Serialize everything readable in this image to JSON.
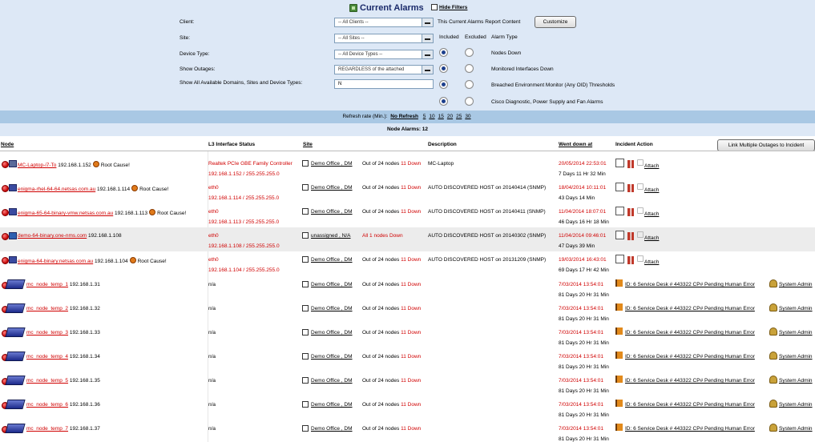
{
  "header": {
    "title": "Current Alarms",
    "hide_filters": "Hide Filters"
  },
  "filters": {
    "client_label": "Client:",
    "client_value": "-- All Clients --",
    "site_label": "Site:",
    "site_value": "-- All Sites --",
    "device_type_label": "Device Type:",
    "device_type_value": "-- All Device Types --",
    "show_outages_label": "Show Outages:",
    "show_outages_value": "REGARDLESS of the attached",
    "show_all_label": "Show All Available Domains, Sites and Device Types:",
    "show_all_value": "N"
  },
  "report": {
    "content_label": "This Current Alarms Report Content",
    "customize_label": "Customize",
    "col_included": "Included",
    "col_excluded": "Excluded",
    "col_alarm_type": "Alarm Type",
    "alarm_types": [
      {
        "label": "Nodes Down",
        "included": true
      },
      {
        "label": "Monitored Interfaces Down",
        "included": true
      },
      {
        "label": "Breached Environment Monitor (Any OID) Thresholds",
        "included": true
      },
      {
        "label": "Cisco Diagnostic, Power Supply and Fan Alarms",
        "included": true
      }
    ]
  },
  "refresh": {
    "label": "Refresh rate (Min.):",
    "current": "No Refresh",
    "options": [
      "5",
      "10",
      "15",
      "20",
      "25",
      "30"
    ]
  },
  "summary": {
    "node_alarms": "Node Alarms: 12"
  },
  "table": {
    "headers": {
      "node": "Node",
      "l3": "L3 Interface Status",
      "site": "Site",
      "description": "Description",
      "went_down": "Went down at",
      "incident_action": "Incident Action"
    },
    "link_multiple_label": "Link Multiple Outages to Incident",
    "root_cause_label": "Root Cause!",
    "attach_label": "Attach",
    "rows": [
      {
        "node_name": "MC-Laptop-i7-To",
        "node_ip": "192.168.1.152",
        "root": true,
        "icon": "laptop-icon",
        "l3_line1": "Realtek PCIe GBE Family Controller",
        "l3_line2": "192.168.1.152 / 255.255.255.0",
        "site": "Demo Office , DM",
        "out_of": "Out of 24 nodes",
        "down": "11 Down",
        "desc": "MC-Laptop",
        "went": "20/05/2014 22:53:01",
        "dur": "7 Days 11 Hr 32 Min",
        "action": "attach",
        "shade": false
      },
      {
        "node_name": "enigma-rhel-64-64.netsas.com.au",
        "node_ip": "192.168.1.114",
        "root": true,
        "icon": "server-icon",
        "l3_line1": "eth0",
        "l3_line2": "192.168.1.114 / 255.255.255.0",
        "site": "Demo Office , DM",
        "out_of": "Out of 24 nodes",
        "down": "11 Down",
        "desc": "AUTO DISCOVERED HOST on 20140414 (SNMP)",
        "went": "18/04/2014 10:11:01",
        "dur": "43 Days 14 Min",
        "action": "attach",
        "shade": false
      },
      {
        "node_name": "enigma-65-64-binary-vmw.netsas.com.au",
        "node_ip": "192.168.1.113",
        "root": true,
        "icon": "server-icon",
        "l3_line1": "eth0",
        "l3_line2": "192.168.1.113 / 255.255.255.0",
        "site": "Demo Office , DM",
        "out_of": "Out of 24 nodes",
        "down": "11 Down",
        "desc": "AUTO DISCOVERED HOST on 20140411 (SNMP)",
        "went": "11/04/2014 18:07:01",
        "dur": "46 Days 16 Hr 18 Min",
        "action": "attach",
        "shade": false
      },
      {
        "node_name": "demo-64-binary.one-nms.com",
        "node_ip": "192.168.1.108",
        "root": false,
        "icon": "pc-icon",
        "l3_line1": "eth0",
        "l3_line2": "192.168.1.108 / 255.255.255.0",
        "site": "unassigned , N/A",
        "out_of": "",
        "down": "All 1 nodes Down",
        "desc": "AUTO DISCOVERED HOST on 20140302 (SNMP)",
        "went": "11/04/2014 09:46:01",
        "dur": "47 Days 39 Min",
        "action": "attach",
        "shade": true
      },
      {
        "node_name": "enigma-64-binary.netsas.com.au",
        "node_ip": "192.168.1.104",
        "root": true,
        "icon": "server-icon",
        "l3_line1": "eth0",
        "l3_line2": "192.168.1.104 / 255.255.255.0",
        "site": "Demo Office , DM",
        "out_of": "Out of 24 nodes",
        "down": "11 Down",
        "desc": "AUTO DISCOVERED HOST on 20131209 (SNMP)",
        "went": "19/03/2014 16:43:01",
        "dur": "69 Days 17 Hr 42 Min",
        "action": "attach",
        "shade": false
      },
      {
        "node_name": "mc_node_temp_1",
        "node_ip": "192.168.1.31",
        "root": false,
        "icon": "switch-icon",
        "l3_line1": "n/a",
        "l3_line2": "",
        "site": "Demo Office , DM",
        "out_of": "Out of 24 nodes",
        "down": "11 Down",
        "desc": "",
        "went": "7/03/2014 13:54:01",
        "dur": "81 Days 20 Hr 31 Min",
        "action": "incident",
        "incident": "ID: 6 Service Desk # 443322 CP# Pending Human Error",
        "owner": "System Admin",
        "shade": false
      },
      {
        "node_name": "mc_node_temp_2",
        "node_ip": "192.168.1.32",
        "root": false,
        "icon": "switch-icon",
        "l3_line1": "n/a",
        "l3_line2": "",
        "site": "Demo Office , DM",
        "out_of": "Out of 24 nodes",
        "down": "11 Down",
        "desc": "",
        "went": "7/03/2014 13:54:01",
        "dur": "81 Days 20 Hr 31 Min",
        "action": "incident",
        "incident": "ID: 6 Service Desk # 443322 CP# Pending Human Error",
        "owner": "System Admin",
        "shade": false
      },
      {
        "node_name": "mc_node_temp_3",
        "node_ip": "192.168.1.33",
        "root": false,
        "icon": "switch-icon",
        "l3_line1": "n/a",
        "l3_line2": "",
        "site": "Demo Office , DM",
        "out_of": "Out of 24 nodes",
        "down": "11 Down",
        "desc": "",
        "went": "7/03/2014 13:54:01",
        "dur": "81 Days 20 Hr 31 Min",
        "action": "incident",
        "incident": "ID: 6 Service Desk # 443322 CP# Pending Human Error",
        "owner": "System Admin",
        "shade": false
      },
      {
        "node_name": "mc_node_temp_4",
        "node_ip": "192.168.1.34",
        "root": false,
        "icon": "switch-icon",
        "l3_line1": "n/a",
        "l3_line2": "",
        "site": "Demo Office , DM",
        "out_of": "Out of 24 nodes",
        "down": "11 Down",
        "desc": "",
        "went": "7/03/2014 13:54:01",
        "dur": "81 Days 20 Hr 31 Min",
        "action": "incident",
        "incident": "ID: 6 Service Desk # 443322 CP# Pending Human Error",
        "owner": "System Admin",
        "shade": false
      },
      {
        "node_name": "mc_node_temp_5",
        "node_ip": "192.168.1.35",
        "root": false,
        "icon": "switch-icon",
        "l3_line1": "n/a",
        "l3_line2": "",
        "site": "Demo Office , DM",
        "out_of": "Out of 24 nodes",
        "down": "11 Down",
        "desc": "",
        "went": "7/03/2014 13:54:01",
        "dur": "81 Days 20 Hr 31 Min",
        "action": "incident",
        "incident": "ID: 6 Service Desk # 443322 CP# Pending Human Error",
        "owner": "System Admin",
        "shade": false
      },
      {
        "node_name": "mc_node_temp_6",
        "node_ip": "192.168.1.36",
        "root": false,
        "icon": "switch-icon",
        "l3_line1": "n/a",
        "l3_line2": "",
        "site": "Demo Office , DM",
        "out_of": "Out of 24 nodes",
        "down": "11 Down",
        "desc": "",
        "went": "7/03/2014 13:54:01",
        "dur": "81 Days 20 Hr 31 Min",
        "action": "incident",
        "incident": "ID: 6 Service Desk # 443322 CP# Pending Human Error",
        "owner": "System Admin",
        "shade": false
      },
      {
        "node_name": "mc_node_temp_7",
        "node_ip": "192.168.1.37",
        "root": false,
        "icon": "switch-icon",
        "l3_line1": "n/a",
        "l3_line2": "",
        "site": "Demo Office , DM",
        "out_of": "Out of 24 nodes",
        "down": "11 Down",
        "desc": "",
        "went": "7/03/2014 13:54:01",
        "dur": "81 Days 20 Hr 31 Min",
        "action": "incident",
        "incident": "ID: 6 Service Desk # 443322 CP# Pending Human Error",
        "owner": "System Admin",
        "shade": false
      }
    ]
  }
}
